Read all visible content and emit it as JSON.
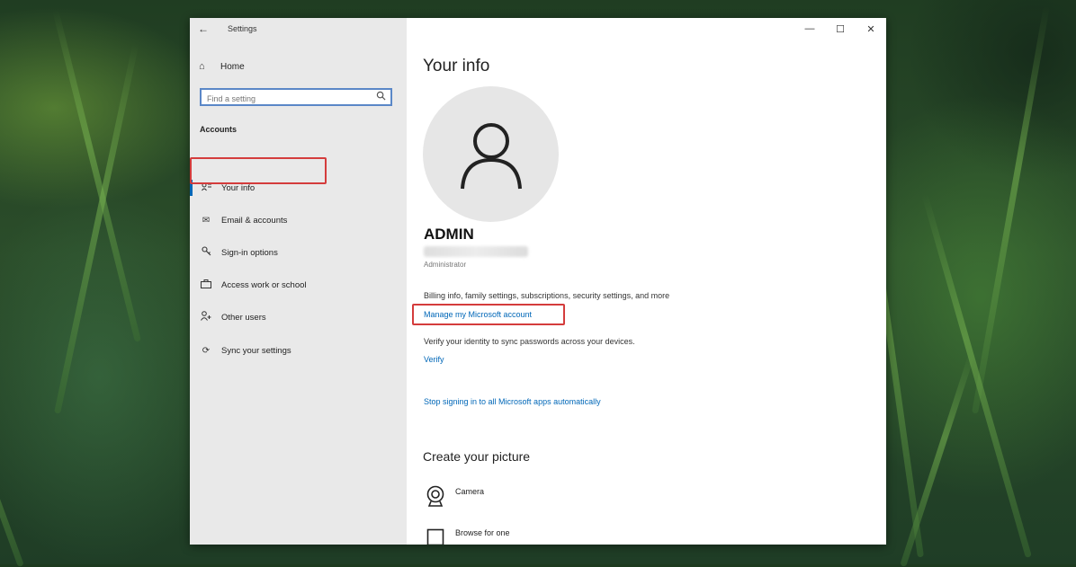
{
  "window": {
    "title": "Settings",
    "controls": {
      "minimize": "—",
      "maximize": "☐",
      "close": "✕"
    },
    "back_glyph": "←"
  },
  "sidebar": {
    "home_label": "Home",
    "home_icon": "home-icon",
    "search": {
      "placeholder": "Find a setting",
      "icon": "search-icon"
    },
    "section_label": "Accounts",
    "items": [
      {
        "label": "Your info",
        "icon": "person-card-icon",
        "active": true
      },
      {
        "label": "Email & accounts",
        "icon": "mail-icon",
        "active": false
      },
      {
        "label": "Sign-in options",
        "icon": "key-icon",
        "active": false
      },
      {
        "label": "Access work or school",
        "icon": "briefcase-icon",
        "active": false
      },
      {
        "label": "Other users",
        "icon": "add-person-icon",
        "active": false
      },
      {
        "label": "Sync your settings",
        "icon": "sync-icon",
        "active": false
      }
    ]
  },
  "main": {
    "title": "Your info",
    "user": {
      "name": "ADMIN",
      "role": "Administrator"
    },
    "billing_text": "Billing info, family settings, subscriptions, security settings, and more",
    "manage_link": "Manage my Microsoft account",
    "verify_text": "Verify your identity to sync passwords across your devices.",
    "verify_link": "Verify",
    "stop_link": "Stop signing in to all Microsoft apps automatically",
    "create_picture_title": "Create your picture",
    "picture_options": [
      {
        "label": "Camera",
        "icon": "camera-icon"
      },
      {
        "label": "Browse for one",
        "icon": "browse-icon"
      }
    ]
  },
  "colors": {
    "accent": "#0067b8",
    "highlight": "#d43c3c",
    "sidebar_bg": "#e9e9e9"
  }
}
